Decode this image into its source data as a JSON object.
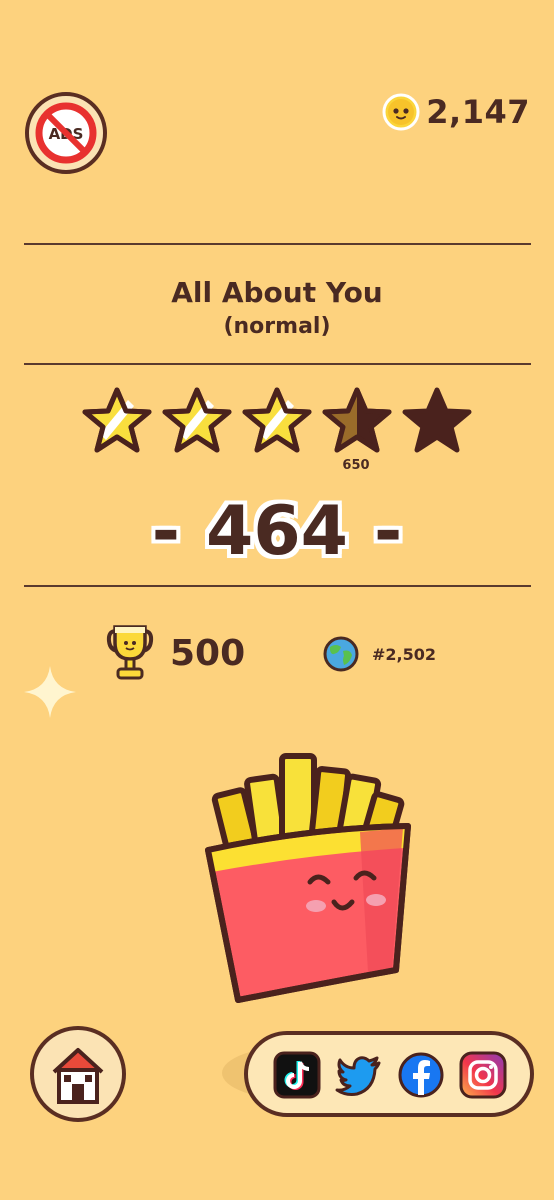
{
  "header": {
    "no_ads_label": "ADS",
    "coins": "2,147"
  },
  "level": {
    "title": "All About You",
    "difficulty": "(normal)"
  },
  "stars": {
    "earned": 3.5,
    "total": 5,
    "next_threshold": "650"
  },
  "score": {
    "dash_left": "-",
    "value": "464",
    "dash_right": "-"
  },
  "stats": {
    "best_score": "500",
    "world_rank": "#2,502"
  },
  "social": {
    "items": [
      "tiktok-icon",
      "twitter-icon",
      "facebook-icon",
      "instagram-icon"
    ]
  },
  "colors": {
    "background": "#fdd27e",
    "text": "#4a2a22",
    "star_filled": "#f9df3e",
    "star_empty": "#4a221d"
  }
}
